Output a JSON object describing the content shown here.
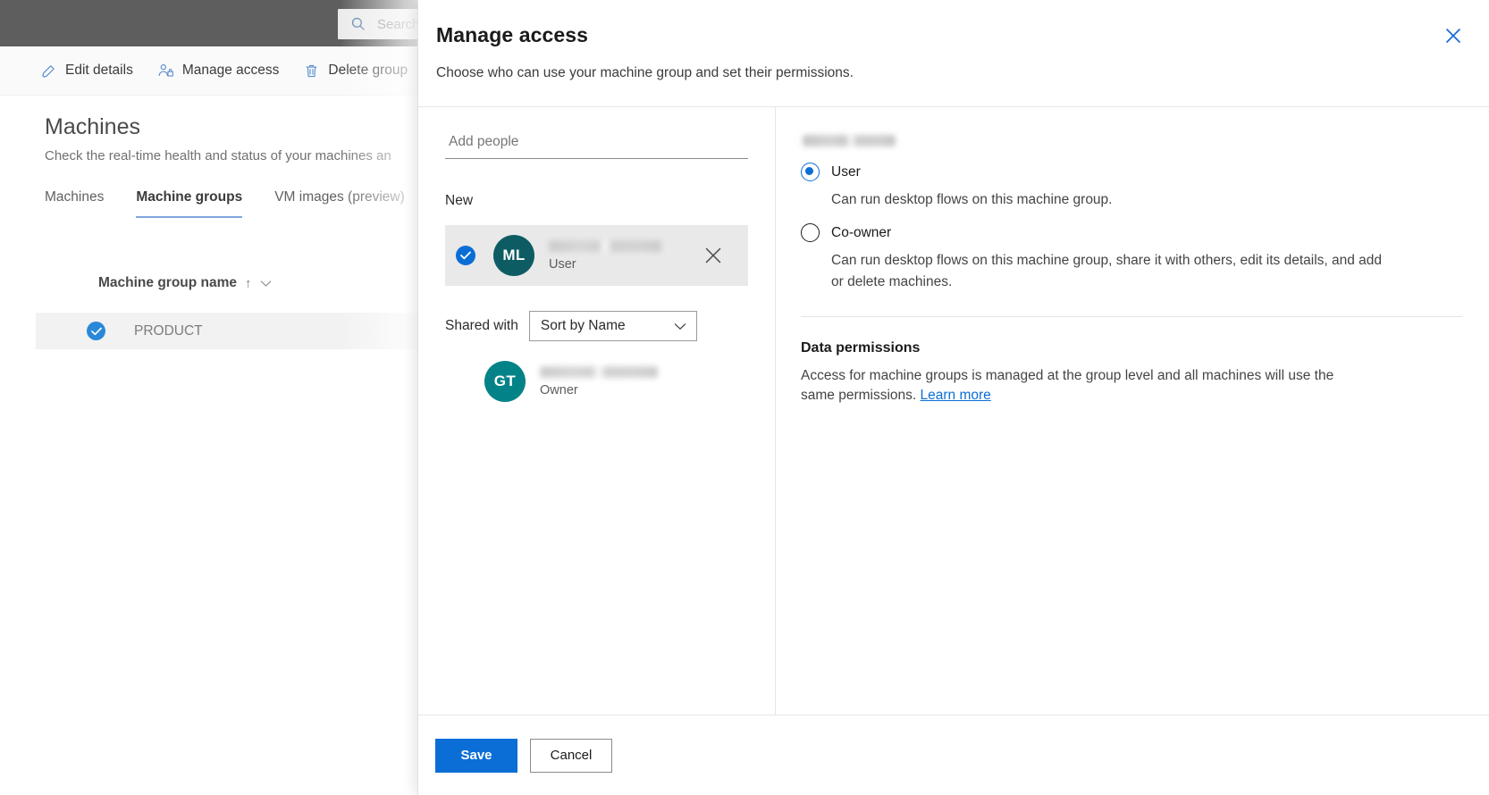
{
  "colors": {
    "topbar_bg": "#5e5e5e",
    "accent_blue": "#0b6ed6",
    "link_blue": "#0b6ed6",
    "tab_underline": "#7fa6dd",
    "avatar_ml": "#0e5c63",
    "avatar_gt": "#038387",
    "row_selected_bg": "#f2f2f2",
    "person_row_bg": "#e9e9e9"
  },
  "topbar": {
    "search": {
      "placeholder": "Search",
      "icon": "search-icon"
    }
  },
  "commandbar": {
    "items": [
      {
        "label": "Edit details",
        "icon": "pencil-icon"
      },
      {
        "label": "Manage access",
        "icon": "people-lock-icon"
      },
      {
        "label": "Delete group",
        "icon": "trash-icon"
      }
    ]
  },
  "page": {
    "title": "Machines",
    "subtitle": "Check the real-time health and status of your machines an",
    "tabs": [
      {
        "label": "Machines",
        "active": false
      },
      {
        "label": "Machine groups",
        "active": true
      },
      {
        "label": "VM images (preview)",
        "active": false
      }
    ],
    "table": {
      "column_header": "Machine group name",
      "sort_indicator": "↑",
      "sort_chevron_icon": "chevron-down-icon",
      "rows": [
        {
          "name": "PRODUCT",
          "selected": true,
          "overflow_icon": "more-vertical-icon"
        }
      ]
    }
  },
  "panel": {
    "title": "Manage access",
    "subtitle": "Choose who can use your machine group and set their permissions.",
    "close_icon": "close-icon",
    "left": {
      "add_people": {
        "placeholder": "Add people",
        "value": ""
      },
      "section_new_label": "New",
      "new_person": {
        "initials": "ML",
        "name_redacted": true,
        "role": "User",
        "selected": true,
        "remove_icon": "close-icon"
      },
      "shared_with_label": "Shared with",
      "sort_select": {
        "value": "Sort by Name",
        "options": [
          "Sort by Name"
        ],
        "chevron_icon": "chevron-down-icon"
      },
      "shared_people": [
        {
          "initials": "GT",
          "name_redacted": true,
          "role": "Owner"
        }
      ]
    },
    "right": {
      "person_name_redacted": true,
      "permission_options": [
        {
          "label": "User",
          "selected": true,
          "description": "Can run desktop flows on this machine group."
        },
        {
          "label": "Co-owner",
          "selected": false,
          "description": "Can run desktop flows on this machine group, share it with others, edit its details, and add or delete machines."
        }
      ],
      "data_permissions": {
        "title": "Data permissions",
        "body": "Access for machine groups is managed at the group level and all machines will use the same permissions. ",
        "link_label": "Learn more"
      }
    },
    "footer": {
      "save_label": "Save",
      "cancel_label": "Cancel"
    }
  }
}
